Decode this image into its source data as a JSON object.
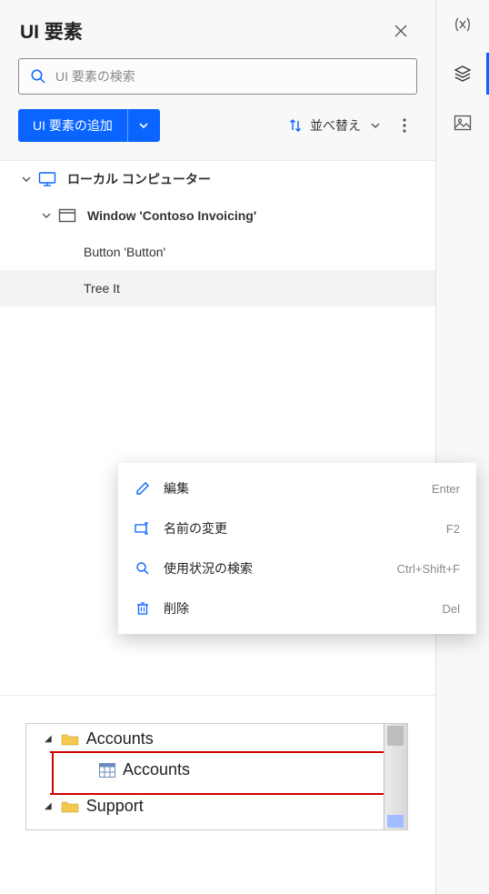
{
  "header": {
    "title": "UI 要素"
  },
  "search": {
    "placeholder": "UI 要素の検索"
  },
  "toolbar": {
    "add_label": "UI 要素の追加",
    "sort_label": "並べ替え"
  },
  "tree": {
    "root_label": "ローカル コンピューター",
    "window_label": "Window 'Contoso Invoicing'",
    "item_button": "Button 'Button'",
    "item_tree": "Tree It"
  },
  "context_menu": {
    "edit": {
      "label": "編集",
      "shortcut": "Enter"
    },
    "rename": {
      "label": "名前の変更",
      "shortcut": "F2"
    },
    "find_usage": {
      "label": "使用状況の検索",
      "shortcut": "Ctrl+Shift+F"
    },
    "delete": {
      "label": "削除",
      "shortcut": "Del"
    }
  },
  "preview": {
    "row1": "Accounts",
    "row2": "Accounts",
    "row3": "Support"
  }
}
